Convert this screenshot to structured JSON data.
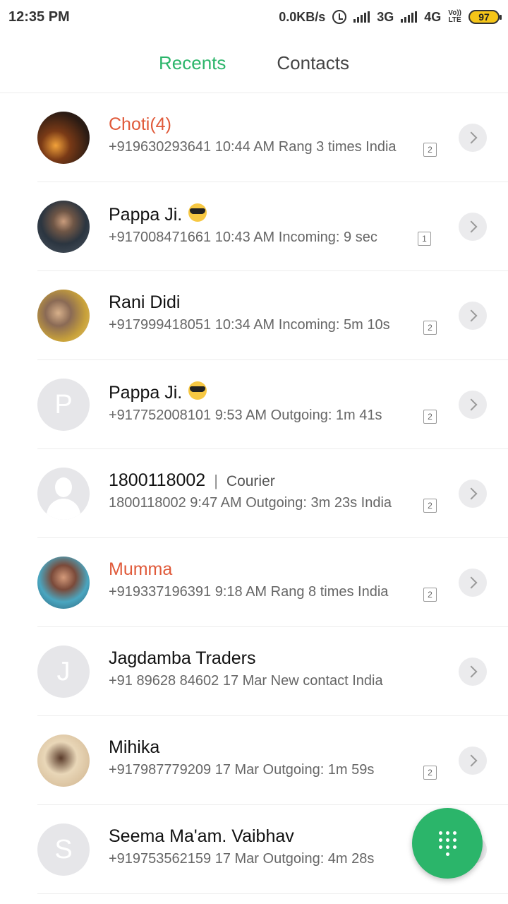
{
  "status_bar": {
    "time": "12:35 PM",
    "net_speed": "0.0KB/s",
    "net1": "3G",
    "net2": "4G",
    "volte_top": "Vo))",
    "volte_bottom": "LTE",
    "battery": "97"
  },
  "tabs": [
    {
      "label": "Recents",
      "active": true
    },
    {
      "label": "Contacts",
      "active": false
    }
  ],
  "calls": [
    {
      "name": "Choti(4)",
      "missed": true,
      "detail": "+919630293641  10:44 AM Rang 3 times  India",
      "sim": "2",
      "avatar": "photo"
    },
    {
      "name": "Pappa Ji.",
      "missed": false,
      "detail": "+917008471661  10:43 AM Incoming: 9 sec",
      "sim": "1",
      "avatar": "photo"
    },
    {
      "name": "Rani Didi",
      "missed": false,
      "detail": "+917999418051  10:34 AM Incoming: 5m 10s",
      "sim": "2",
      "avatar": "photo"
    },
    {
      "name": "Pappa Ji.",
      "missed": false,
      "detail": "+917752008101  9:53 AM Outgoing: 1m 41s",
      "sim": "2",
      "avatar_letter": "P"
    },
    {
      "name": "1800118002",
      "tag": "Courier",
      "missed": false,
      "detail": "1800118002  9:47 AM Outgoing: 3m 23s  India",
      "sim": "2",
      "avatar": "silhouette"
    },
    {
      "name": "Mumma",
      "missed": true,
      "detail": "+919337196391  9:18 AM Rang 8 times  India",
      "sim": "2",
      "avatar": "photo"
    },
    {
      "name": "Jagdamba Traders",
      "missed": false,
      "detail": "+91 89628 84602  17 Mar New contact  India",
      "sim": "",
      "avatar_letter": "J"
    },
    {
      "name": "Mihika",
      "missed": false,
      "detail": "+917987779209  17 Mar Outgoing: 1m 59s",
      "sim": "2",
      "avatar": "photo"
    },
    {
      "name": "Seema Ma'am. Vaibhav",
      "missed": false,
      "detail": "+919753562159  17 Mar Outgoing: 4m 28s",
      "sim": "",
      "avatar_letter": "S"
    }
  ],
  "colors": {
    "accent": "#2bb56a",
    "missed": "#e05a3a"
  },
  "icons": {
    "fab": "dialpad-icon",
    "row_action": "chevron-right-icon"
  }
}
